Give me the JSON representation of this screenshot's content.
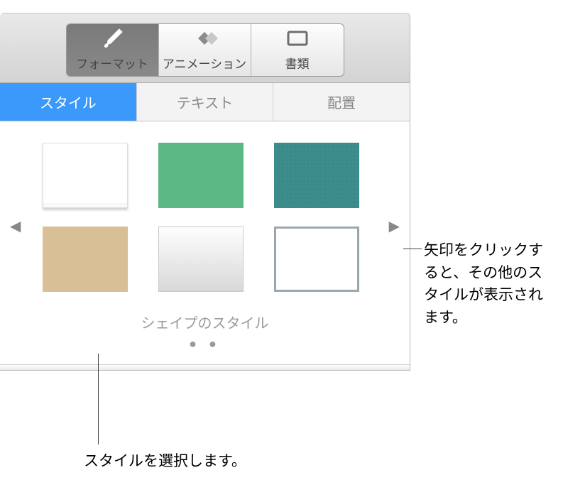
{
  "toolbar": {
    "format": "フォーマット",
    "animation": "アニメーション",
    "document": "書類"
  },
  "subtabs": {
    "style": "スタイル",
    "text": "テキスト",
    "arrange": "配置"
  },
  "stylesCaption": "シェイプのスタイル",
  "callouts": {
    "right": "矢印をクリックすると、その他のスタイルが表示されます。",
    "bottom": "スタイルを選択します。"
  }
}
